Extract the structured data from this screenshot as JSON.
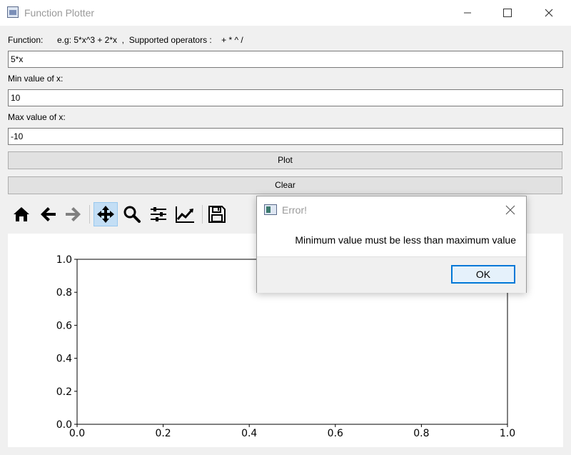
{
  "window": {
    "title": "Function Plotter",
    "icon": "app-window-icon",
    "controls": [
      "minimize-icon",
      "maximize-icon",
      "close-icon"
    ]
  },
  "form": {
    "function_label": "Function:",
    "function_hint": "e.g: 5*x^3 + 2*x  ,  Supported operators :    + * ^ /",
    "function_value": "5*x",
    "min_label": "Min value of x:",
    "min_value": "10",
    "max_label": "Max value of x:",
    "max_value": "-10",
    "plot_label": "Plot",
    "clear_label": "Clear"
  },
  "toolbar": {
    "items": [
      "home-icon",
      "back-icon",
      "forward-icon",
      "pan-icon",
      "zoom-icon",
      "subplots-icon",
      "customize-icon",
      "save-icon"
    ],
    "active": "pan-icon"
  },
  "chart_data": {
    "type": "line",
    "series": [],
    "xlim": [
      0.0,
      1.0
    ],
    "ylim": [
      0.0,
      1.0
    ],
    "xticks": [
      "0.0",
      "0.2",
      "0.4",
      "0.6",
      "0.8",
      "1.0"
    ],
    "yticks": [
      "0.0",
      "0.2",
      "0.4",
      "0.6",
      "0.8",
      "1.0"
    ],
    "grid": false,
    "title": "",
    "xlabel": "",
    "ylabel": ""
  },
  "dialog": {
    "title": "Error!",
    "message": "Minimum value must be less than maximum value",
    "ok_label": "OK"
  }
}
